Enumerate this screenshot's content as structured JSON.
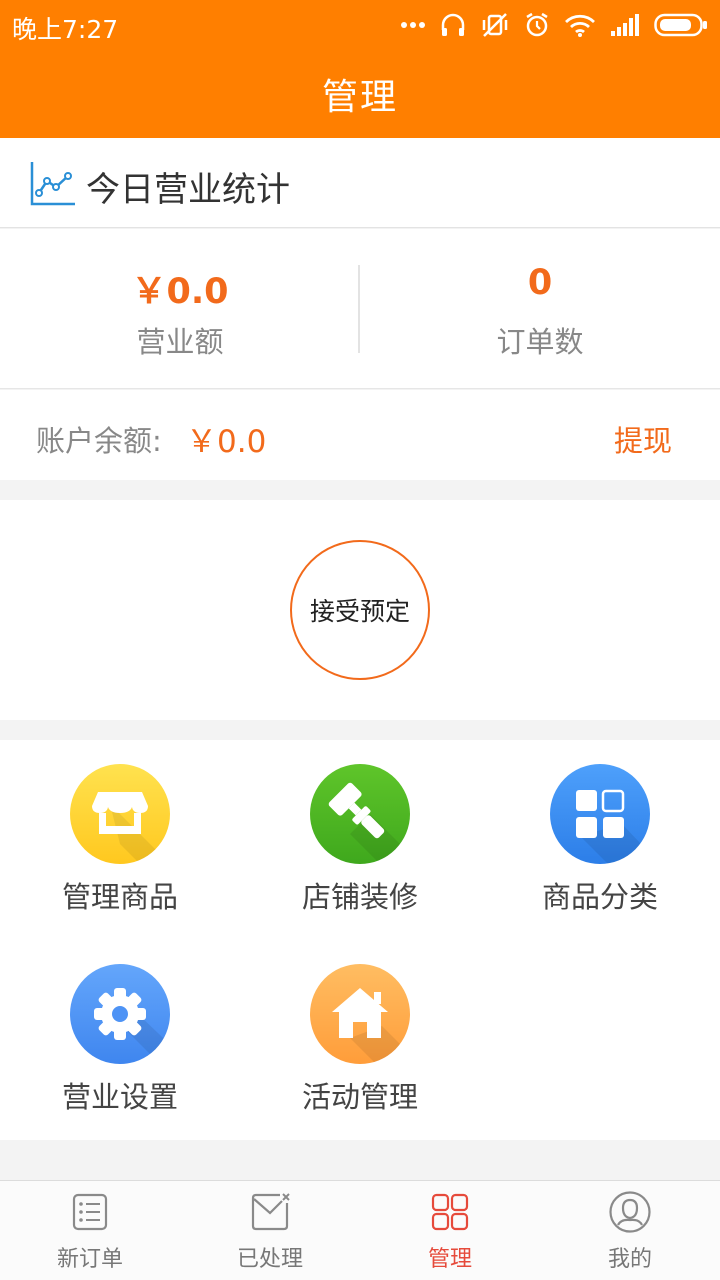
{
  "status_bar": {
    "time": "晚上7:27"
  },
  "nav": {
    "title": "管理"
  },
  "stats": {
    "title": "今日营业统计",
    "revenue": {
      "value": "￥0.0",
      "label": "营业额"
    },
    "orders": {
      "value": "0",
      "label": "订单数"
    }
  },
  "balance": {
    "label": "账户余额:",
    "value": "￥0.0",
    "withdraw": "提现"
  },
  "reserve_button": "接受预定",
  "menu": [
    {
      "label": "管理商品",
      "icon": "store-icon",
      "color": "#ffd43a"
    },
    {
      "label": "店铺装修",
      "icon": "paint-roller-icon",
      "color": "#55b826"
    },
    {
      "label": "商品分类",
      "icon": "category-grid-icon",
      "color": "#3d8ef3"
    },
    {
      "label": "营业设置",
      "icon": "gear-icon",
      "color": "#4e93f5"
    },
    {
      "label": "活动管理",
      "icon": "house-icon",
      "color": "#ffad4f"
    }
  ],
  "tabs": [
    {
      "label": "新订单",
      "icon": "order-list-icon"
    },
    {
      "label": "已处理",
      "icon": "processed-envelope-icon"
    },
    {
      "label": "管理",
      "icon": "manage-grid-icon",
      "active": true
    },
    {
      "label": "我的",
      "icon": "profile-icon"
    }
  ],
  "colors": {
    "brand": "#ff7f00",
    "accent": "#f26a1b",
    "active_tab": "#e64a3b"
  }
}
